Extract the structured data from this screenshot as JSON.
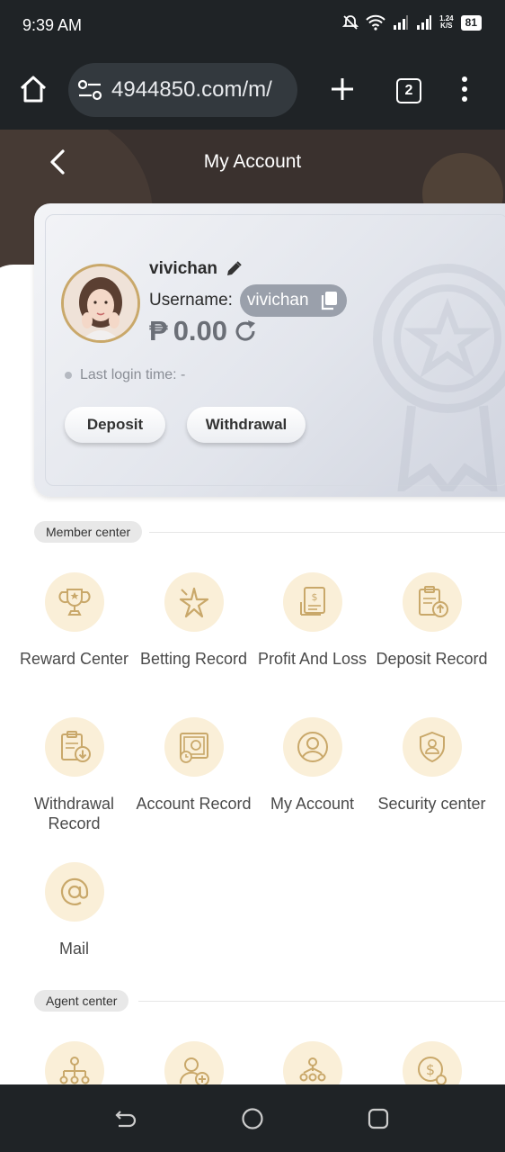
{
  "status_bar": {
    "time": "9:39 AM",
    "speed_top": "1.24",
    "speed_bottom": "K/S",
    "battery": "81"
  },
  "browser": {
    "url": "4944850.com/m/",
    "tab_count": "2"
  },
  "header": {
    "title": "My Account"
  },
  "account": {
    "nickname": "vivichan",
    "username_label": "Username:",
    "username": "vivichan",
    "currency": "₱",
    "balance": "0.00",
    "last_login": "Last login time: -",
    "deposit_label": "Deposit",
    "withdraw_label": "Withdrawal"
  },
  "member_center": {
    "title": "Member center",
    "items": [
      {
        "label": "Reward Center",
        "icon": "trophy-icon"
      },
      {
        "label": "Betting Record",
        "icon": "star-burst-icon"
      },
      {
        "label": "Profit And Loss",
        "icon": "document-dollar-icon"
      },
      {
        "label": "Deposit Record",
        "icon": "clipboard-upload-icon"
      },
      {
        "label": "Withdrawal Record",
        "icon": "clipboard-download-icon"
      },
      {
        "label": "Account Record",
        "icon": "safe-clock-icon"
      },
      {
        "label": "My Account",
        "icon": "user-circle-icon"
      },
      {
        "label": "Security center",
        "icon": "shield-user-icon"
      },
      {
        "label": "Mail",
        "icon": "at-sign-icon"
      }
    ]
  },
  "agent_center": {
    "title": "Agent center",
    "items": [
      {
        "icon": "org-chart-icon"
      },
      {
        "icon": "add-user-icon"
      },
      {
        "icon": "team-tree-icon"
      },
      {
        "icon": "money-gear-icon"
      }
    ]
  },
  "colors": {
    "accent": "#c9a86a",
    "icon_bg": "#faefd8",
    "header_bg": "#3a312e",
    "system_bar": "#1f2326"
  }
}
